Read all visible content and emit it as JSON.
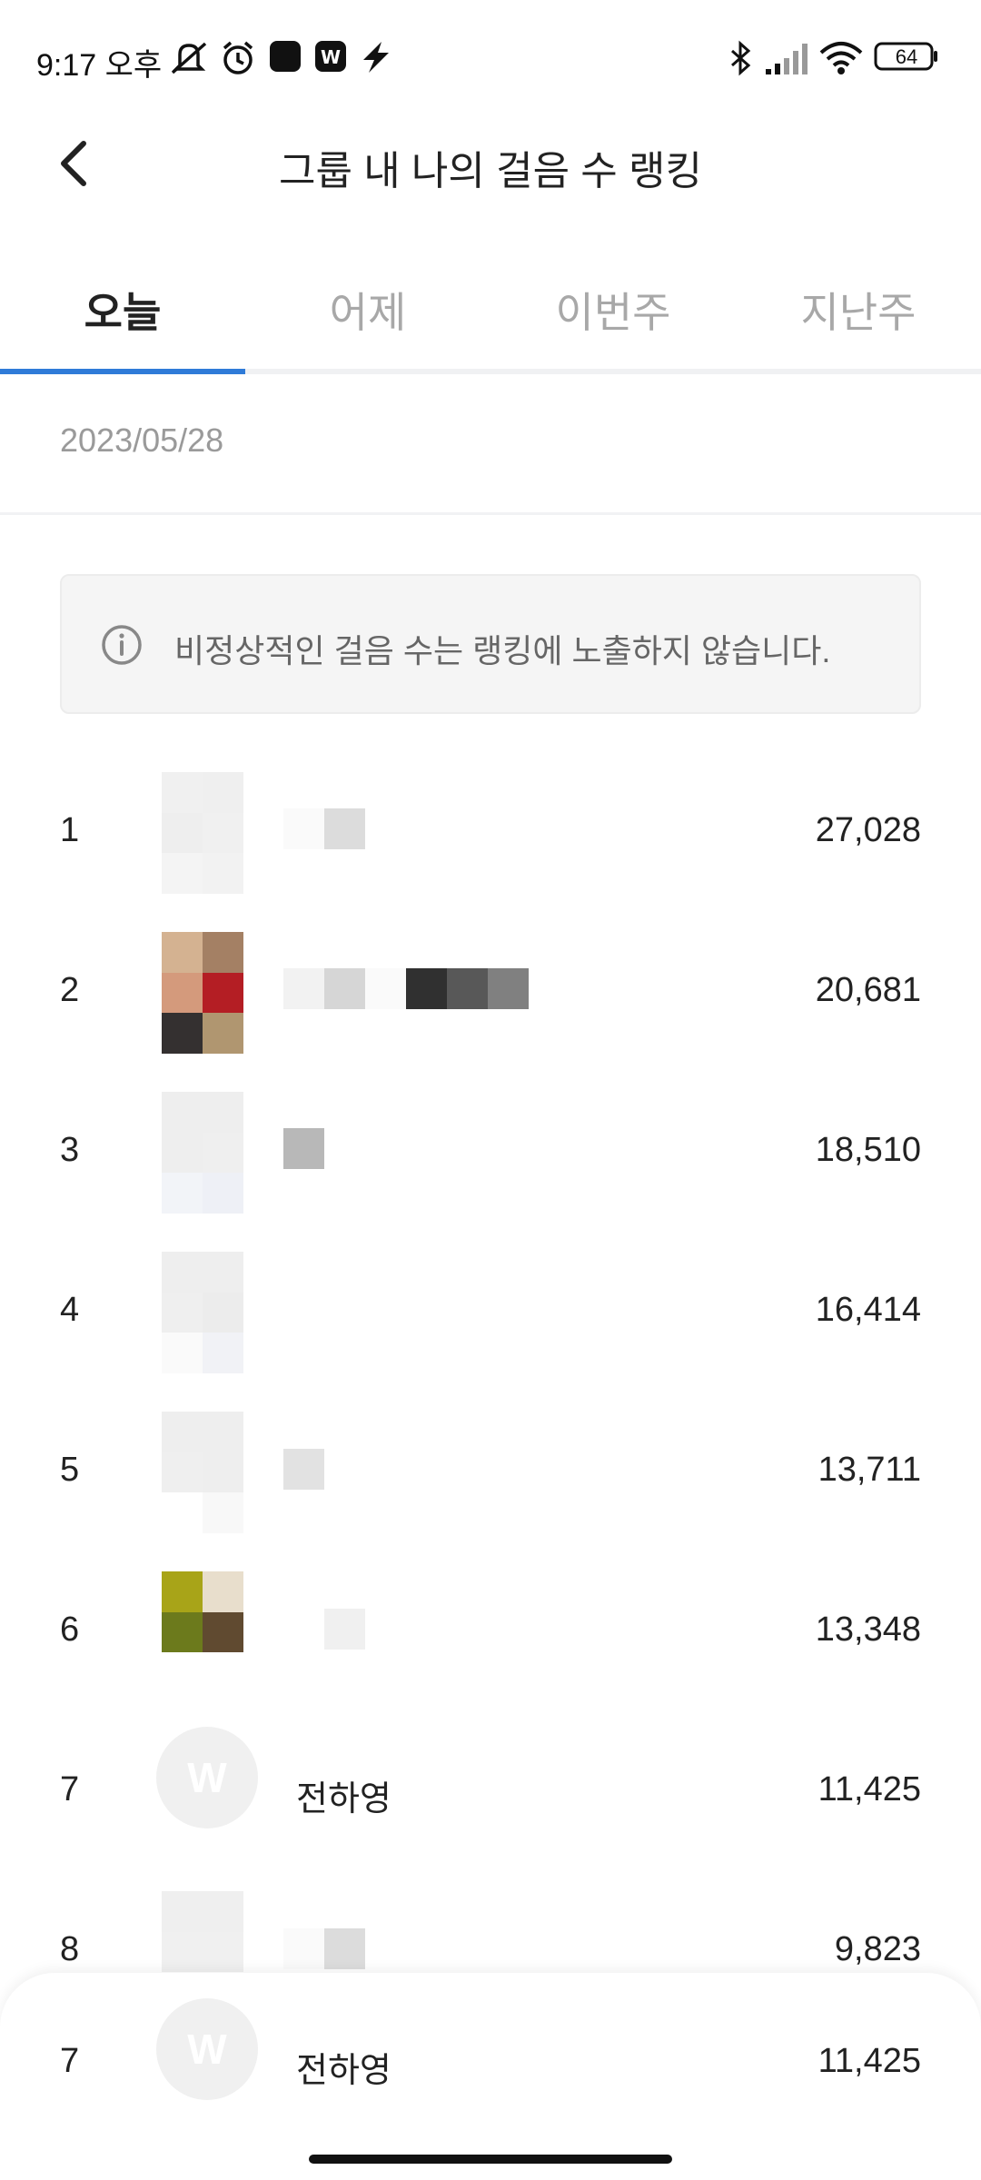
{
  "status_bar": {
    "time": "9:17 오후",
    "battery": "64",
    "icons": [
      "mute-icon",
      "alarm-icon",
      "app-black-icon",
      "app-w-icon",
      "flash-icon",
      "bluetooth-icon",
      "signal-icon",
      "wifi-icon",
      "battery-icon"
    ]
  },
  "header": {
    "title": "그룹 내 나의 걸음 수 랭킹",
    "back_icon": "chevron-left-icon"
  },
  "tabs": [
    {
      "label": "오늘",
      "active": true
    },
    {
      "label": "어제",
      "active": false
    },
    {
      "label": "이번주",
      "active": false
    },
    {
      "label": "지난주",
      "active": false
    }
  ],
  "date": "2023/05/28",
  "notice": {
    "icon": "info-icon",
    "text": "비정상적인 걸음 수는 랭킹에 노출하지 않습니다."
  },
  "ranking": [
    {
      "rank": "1",
      "name": "",
      "steps": "27,028"
    },
    {
      "rank": "2",
      "name": "",
      "steps": "20,681"
    },
    {
      "rank": "3",
      "name": "",
      "steps": "18,510"
    },
    {
      "rank": "4",
      "name": "",
      "steps": "16,414"
    },
    {
      "rank": "5",
      "name": "",
      "steps": "13,711"
    },
    {
      "rank": "6",
      "name": "",
      "steps": "13,348"
    },
    {
      "rank": "7",
      "name": "전하영",
      "steps": "11,425"
    },
    {
      "rank": "8",
      "name": "",
      "steps": "9,823"
    }
  ],
  "my_rank": {
    "rank": "7",
    "name": "전하영",
    "steps": "11,425",
    "avatar_letter": "W"
  },
  "colors": {
    "tab_indicator": "#2f7bd8",
    "inactive_tab": "#a8a8a8",
    "notice_bg": "#f5f5f5"
  }
}
